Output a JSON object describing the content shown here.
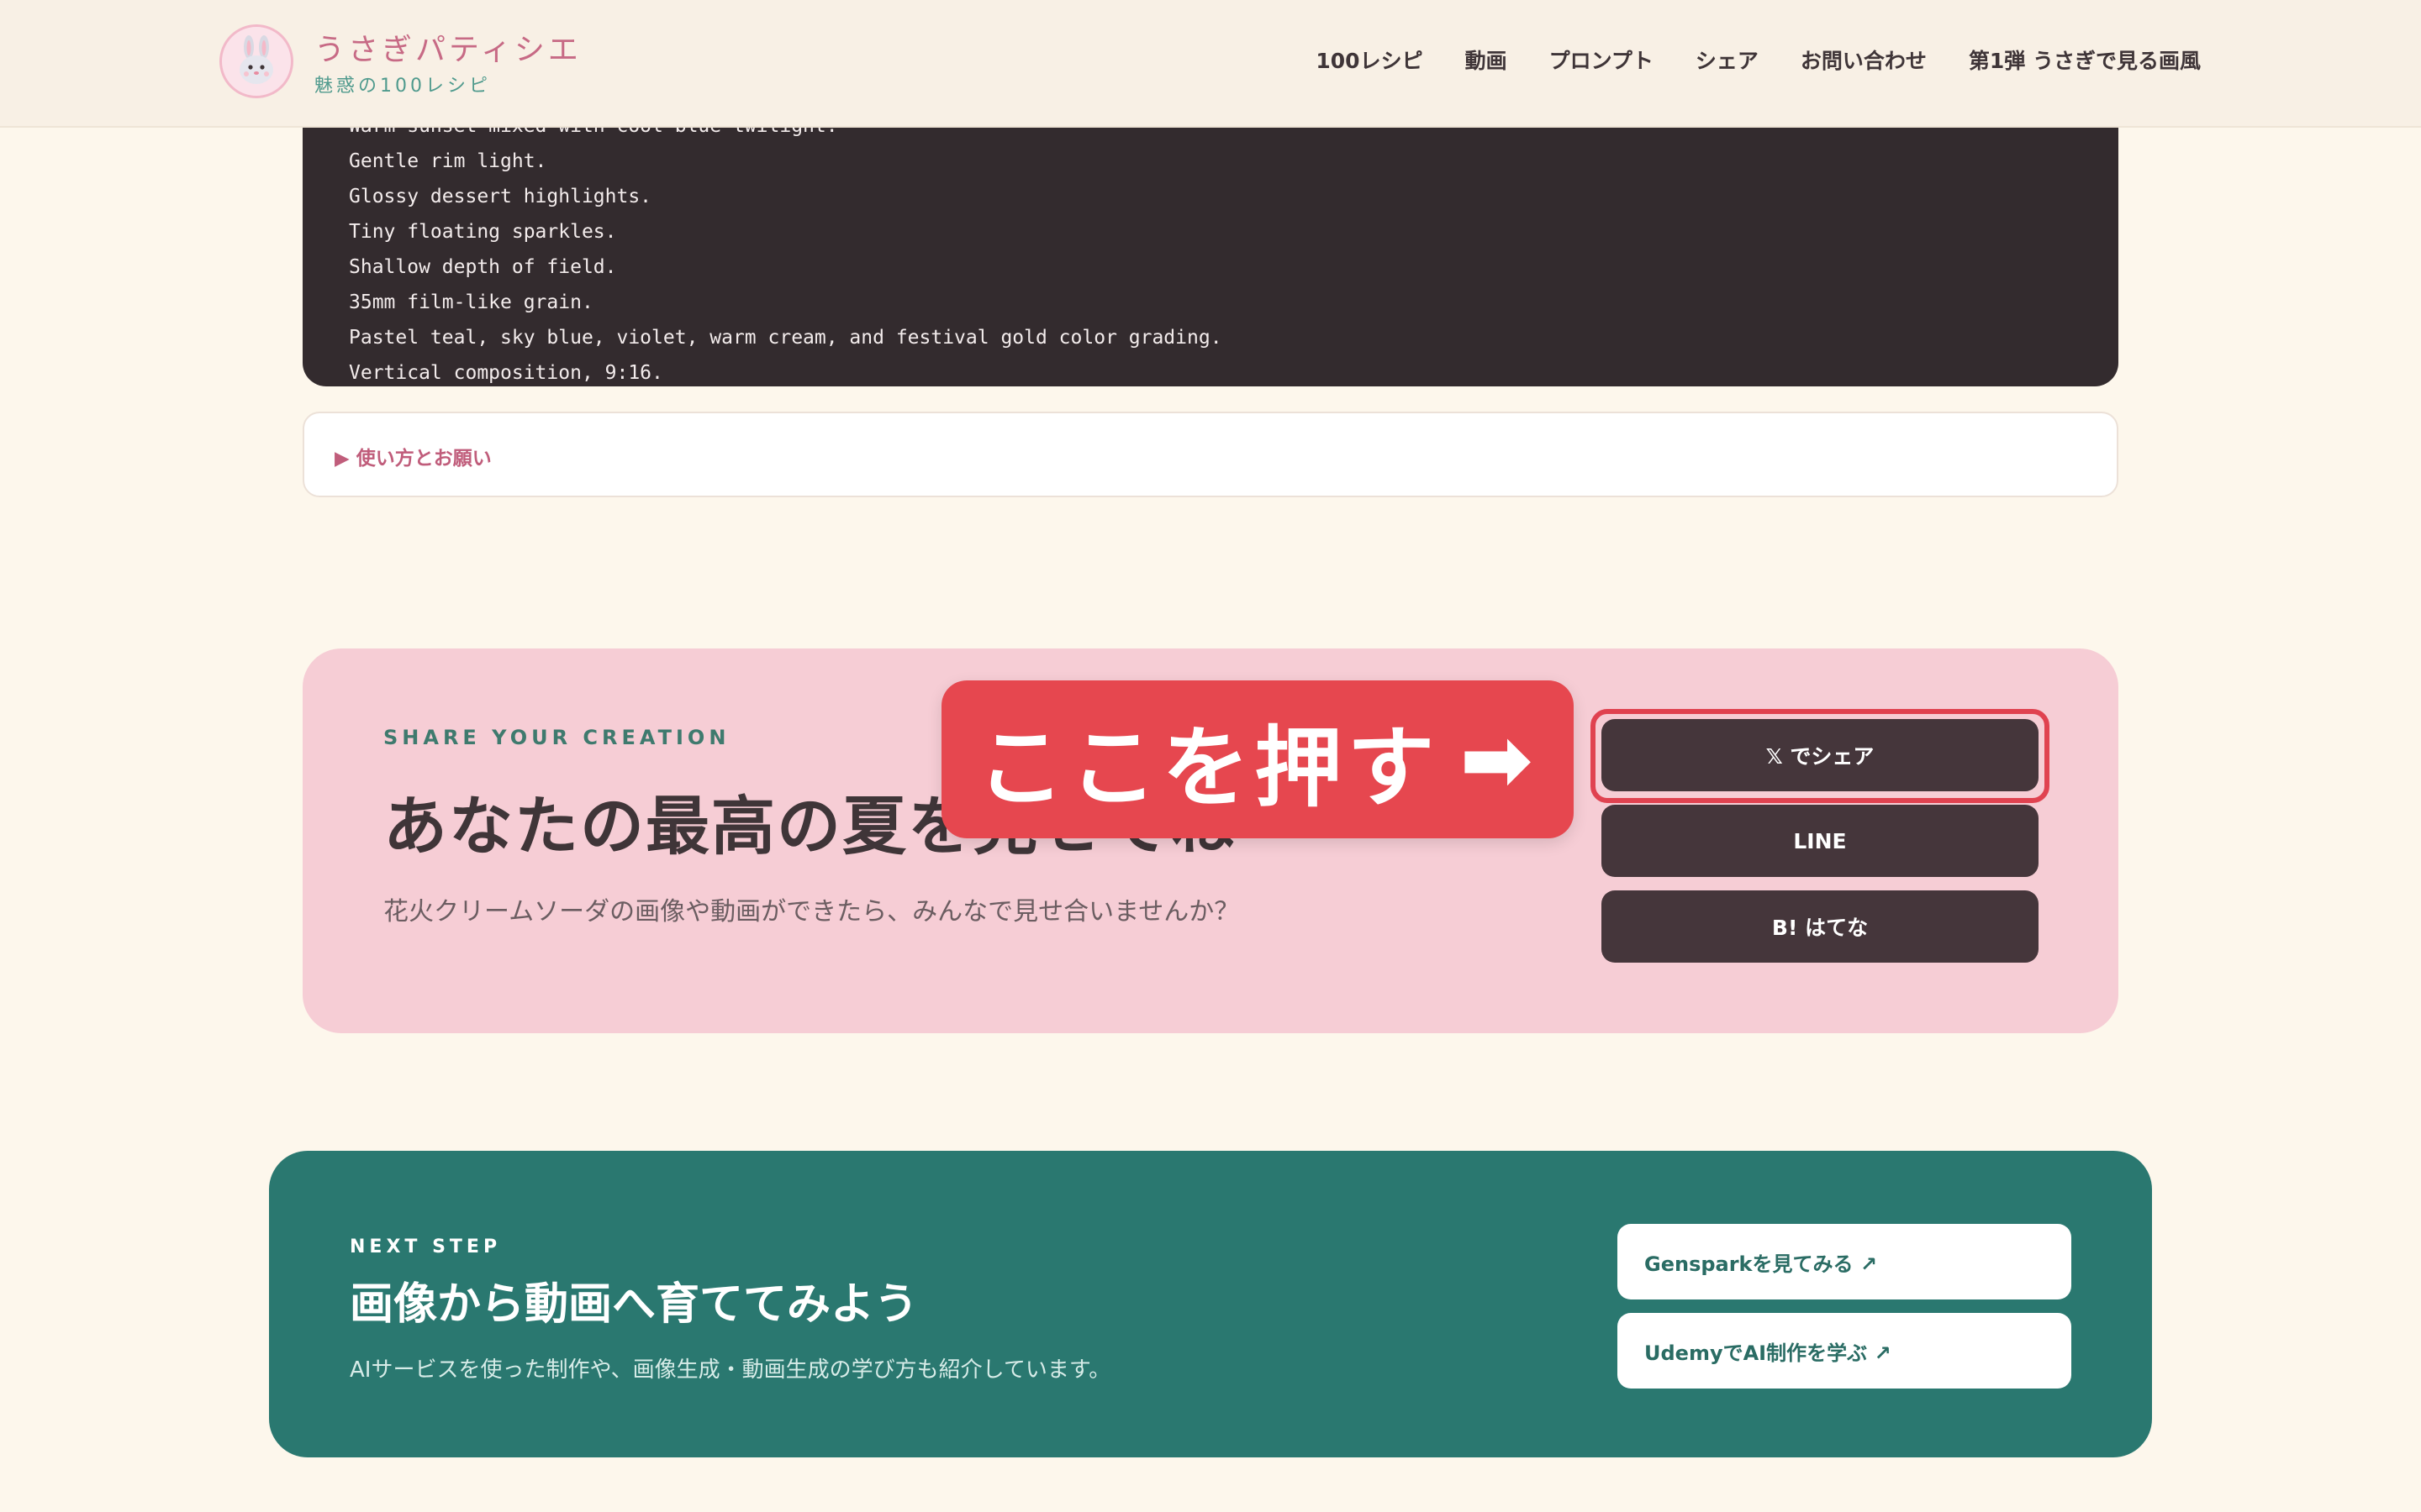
{
  "header": {
    "brand_name": "うさぎパティシエ",
    "brand_sub": "魅惑の100レシピ",
    "nav": [
      "100レシピ",
      "動画",
      "プロンプト",
      "シェア",
      "お問い合わせ",
      "第1弾 うさぎで見る画風"
    ]
  },
  "code": {
    "lines": [
      "Warm sunset mixed with cool blue twilight.",
      "Gentle rim light.",
      "Glossy dessert highlights.",
      "Tiny floating sparkles.",
      "Shallow depth of field.",
      "35mm film-like grain.",
      "Pastel teal, sky blue, violet, warm cream, and festival gold color grading.",
      "Vertical composition, 9:16."
    ]
  },
  "details": {
    "label": "▶ 使い方とお願い"
  },
  "share": {
    "eyebrow": "SHARE YOUR CREATION",
    "title": "あなたの最高の夏を見せてね",
    "description": "花火クリームソーダの画像や動画ができたら、みんなで見せ合いませんか？",
    "buttons": [
      "𝕏 でシェア",
      "LINE",
      "B! はてな"
    ]
  },
  "callout": {
    "text": "ここを押す",
    "arrow": "➡"
  },
  "next_step": {
    "eyebrow": "NEXT STEP",
    "title": "画像から動画へ育ててみよう",
    "description": "AIサービスを使った制作や、画像生成・動画生成の学び方も紹介しています。",
    "links": [
      "Gensparkを見てみる ↗",
      "UdemyでAI制作を学ぶ ↗"
    ]
  },
  "colors": {
    "background": "#fdf7ec",
    "brand_pink": "#c76a85",
    "share_bg": "#f6cdd5",
    "button_dark": "#45363b",
    "callout_red": "#e6474f",
    "next_teal": "#2a7870"
  }
}
